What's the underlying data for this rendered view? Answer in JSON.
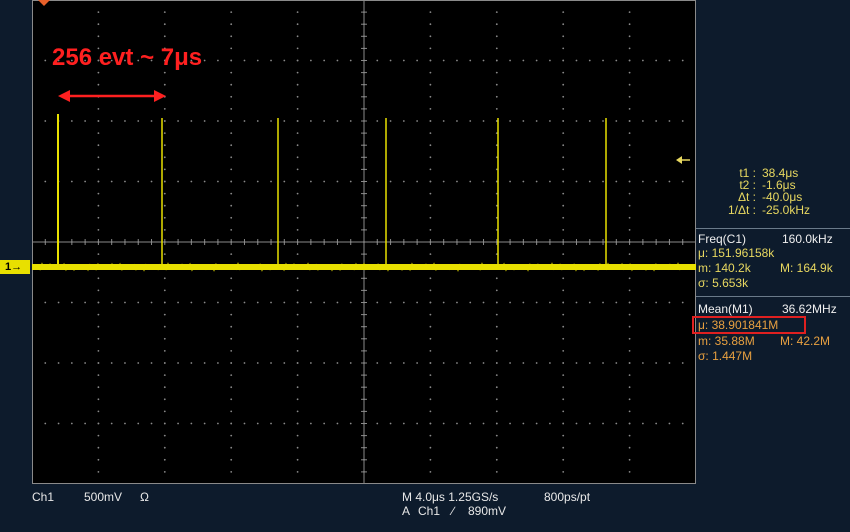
{
  "annotation": {
    "text": "256 evt ~ 7μs",
    "color": "#ff2020"
  },
  "channel_marker": {
    "label": "1→",
    "color": "#e8e000"
  },
  "trace": {
    "color": "#e8e000"
  },
  "cursors": [
    {
      "label": "t1 :",
      "value": "38.4μs"
    },
    {
      "label": "t2 :",
      "value": "-1.6μs"
    },
    {
      "label": "Δt :",
      "value": "-40.0μs"
    },
    {
      "label": "1/Δt :",
      "value": "-25.0kHz"
    }
  ],
  "freq": {
    "title": "Freq(C1)",
    "value": "160.0kHz",
    "mean": "μ: 151.96158k",
    "min": "m: 140.2k",
    "max": "M: 164.9k",
    "sigma": "σ: 5.653k"
  },
  "mean_meas": {
    "title": "Mean(M1)",
    "value": "36.62MHz",
    "mean": "μ: 38.901841M",
    "min": "m: 35.88M",
    "max": "M: 42.2M",
    "sigma": "σ: 1.447M"
  },
  "bottom": {
    "ch": "Ch1",
    "volts": "500mV",
    "ohm": "Ω",
    "timebase": "M 4.0μs 1.25GS/s",
    "resolution": "800ps/pt",
    "trigger_prefix": "A",
    "trigger_ch": "Ch1",
    "trigger_slope": "∕",
    "trigger_level": "890mV"
  },
  "colors": {
    "background": "#0d1b2c",
    "screen": "#000000",
    "grid": "#8a8a8a",
    "readout_yellow": "#e8d860",
    "readout_orange": "#e8a040",
    "highlight_box": "#e02020"
  }
}
